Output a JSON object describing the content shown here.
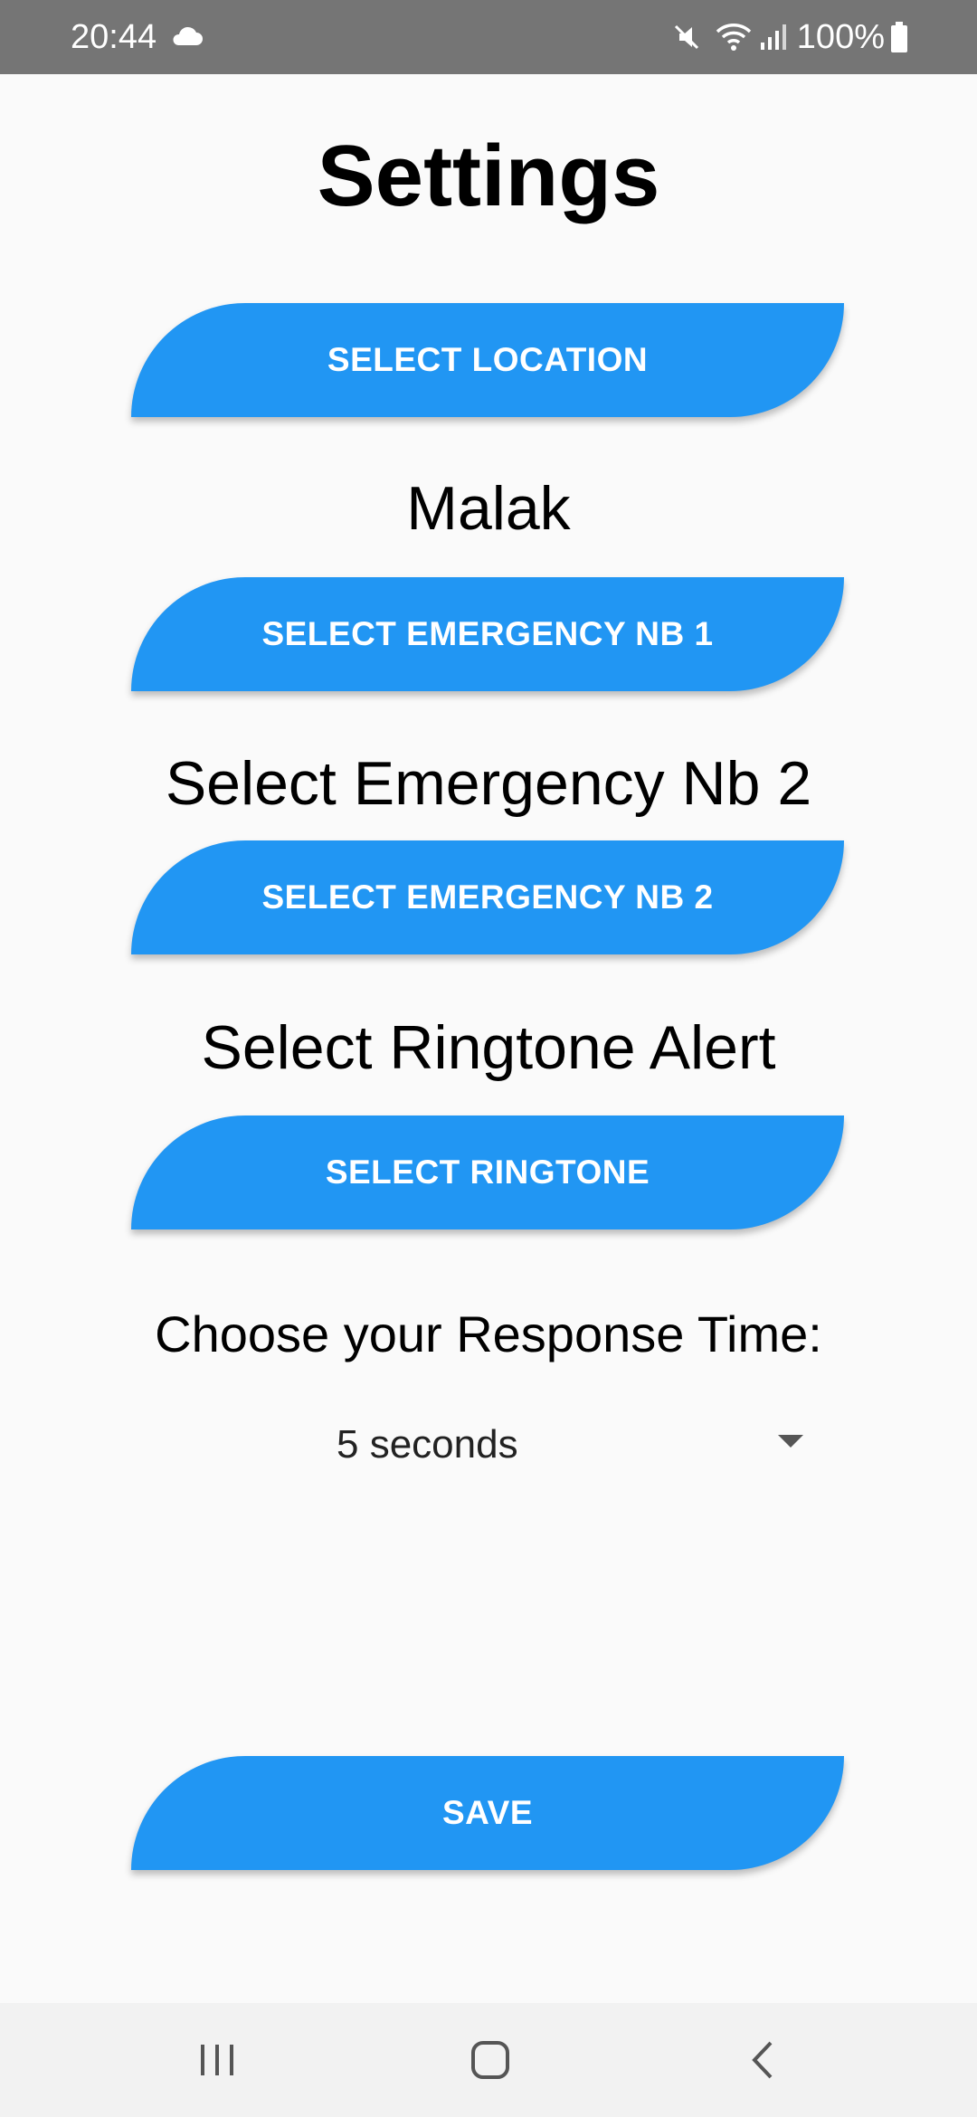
{
  "status_bar": {
    "time": "20:44",
    "battery_text": "100%",
    "icons": [
      "cloud-icon",
      "mute-icon",
      "wifi-icon",
      "signal-icon",
      "battery-icon"
    ]
  },
  "page": {
    "title": "Settings"
  },
  "buttons": {
    "select_location": "SELECT LOCATION",
    "select_emergency_1": "SELECT EMERGENCY NB 1",
    "select_emergency_2": "SELECT EMERGENCY NB 2",
    "select_ringtone": "SELECT RINGTONE",
    "save": "SAVE"
  },
  "labels": {
    "emergency_1_value": "Malak",
    "emergency_2_value": "Select Emergency Nb 2",
    "ringtone_value": "Select Ringtone Alert",
    "response_time": "Choose your Response Time:"
  },
  "response_time_dropdown": {
    "selected": "5 seconds"
  },
  "navigation": {
    "items": [
      "recent-apps-icon",
      "home-icon",
      "back-icon"
    ]
  },
  "colors": {
    "accent": "#2196f3",
    "status_bar": "#757575",
    "background": "#fafafa",
    "nav_bar": "#f2f2f2"
  }
}
